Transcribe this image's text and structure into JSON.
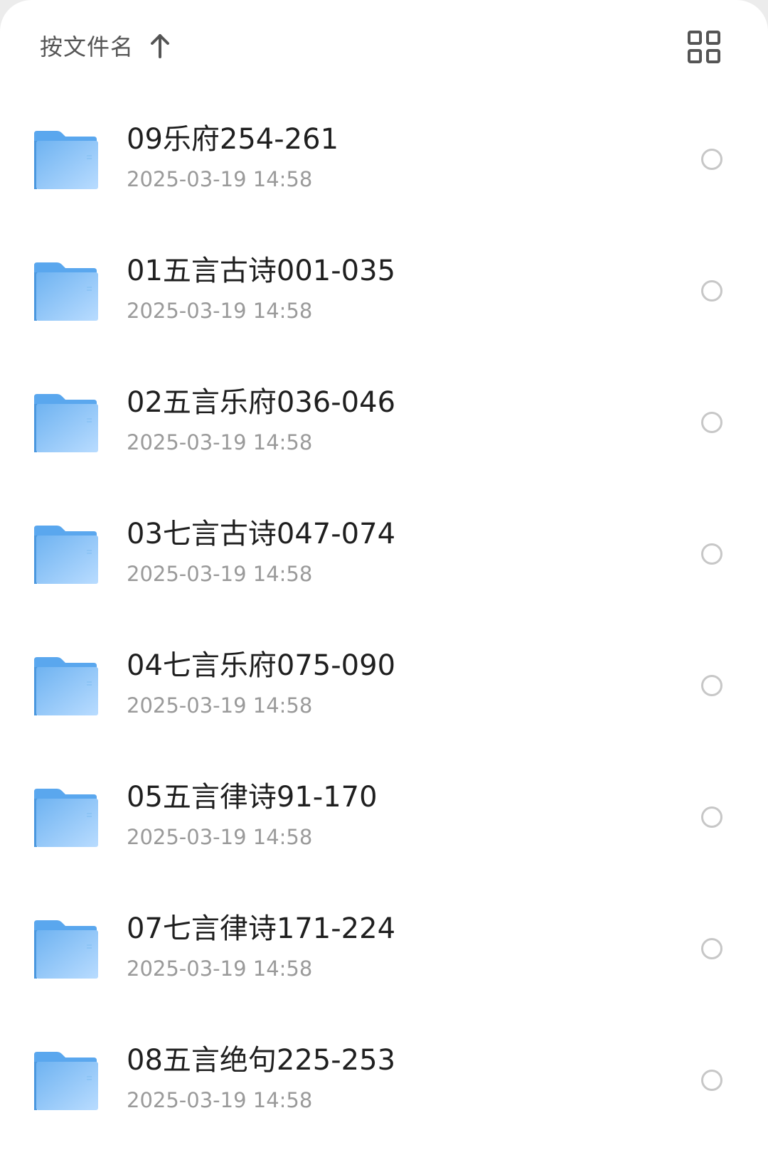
{
  "header": {
    "sort_label": "按文件名",
    "sort_direction_icon": "arrow-up-icon",
    "view_toggle_icon": "grid-view-icon"
  },
  "colors": {
    "folder_light": "#b9dcff",
    "folder_dark": "#5aa7ee",
    "title_text": "#1f1f1f",
    "date_text": "#9a9a9a",
    "checkbox_border": "#c7c7c7"
  },
  "files": [
    {
      "name": "09乐府254-261",
      "date": "2025-03-19 14:58",
      "icon": "folder-icon"
    },
    {
      "name": "01五言古诗001-035",
      "date": "2025-03-19 14:58",
      "icon": "folder-icon"
    },
    {
      "name": "02五言乐府036-046",
      "date": "2025-03-19 14:58",
      "icon": "folder-icon"
    },
    {
      "name": "03七言古诗047-074",
      "date": "2025-03-19 14:58",
      "icon": "folder-icon"
    },
    {
      "name": "04七言乐府075-090",
      "date": "2025-03-19 14:58",
      "icon": "folder-icon"
    },
    {
      "name": "05五言律诗91-170",
      "date": "2025-03-19 14:58",
      "icon": "folder-icon"
    },
    {
      "name": "07七言律诗171-224",
      "date": "2025-03-19 14:58",
      "icon": "folder-icon"
    },
    {
      "name": "08五言绝句225-253",
      "date": "2025-03-19 14:58",
      "icon": "folder-icon"
    }
  ]
}
